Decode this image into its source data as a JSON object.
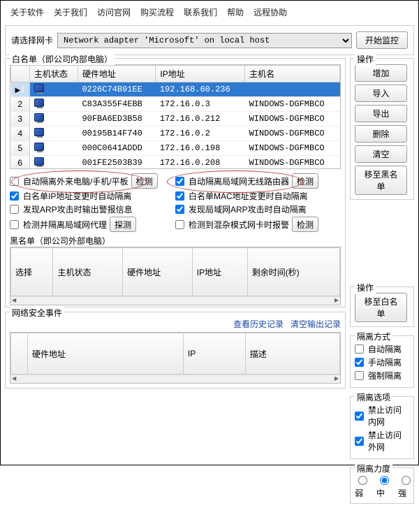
{
  "menubar": [
    "关于软件",
    "关于我们",
    "访问官网",
    "购买流程",
    "联系我们",
    "帮助",
    "远程协助"
  ],
  "adapter": {
    "label": "请选择网卡",
    "value": "Network adapter 'Microsoft' on local host"
  },
  "start_monitor": "开始监控",
  "whitelist": {
    "title": "白名单（即公司内部电脑）",
    "cols": [
      "主机状态",
      "硬件地址",
      "IP地址",
      "主机名"
    ],
    "rows": [
      {
        "n": "1",
        "mac": "0226C74B91EE",
        "ip": "192.168.60.236",
        "host": "",
        "sel": true
      },
      {
        "n": "2",
        "mac": "C83A355F4EBB",
        "ip": "172.16.0.3",
        "host": "WINDOWS-DGFMBCO"
      },
      {
        "n": "3",
        "mac": "90FBA6ED3B58",
        "ip": "172.16.0.212",
        "host": "WINDOWS-DGFMBCO"
      },
      {
        "n": "4",
        "mac": "00195B14F740",
        "ip": "172.16.0.2",
        "host": "WINDOWS-DGFMBCO"
      },
      {
        "n": "5",
        "mac": "000C0641ADDD",
        "ip": "172.16.0.198",
        "host": "WINDOWS-DGFMBCO"
      },
      {
        "n": "6",
        "mac": "001FE2503B39",
        "ip": "172.16.0.208",
        "host": "WINDOWS-DGFMBCO"
      }
    ]
  },
  "ops": {
    "title": "操作",
    "add": "增加",
    "import": "导入",
    "export": "导出",
    "delete": "删除",
    "clear": "清空",
    "to_black": "移至黑名单",
    "to_white": "移至白名单"
  },
  "opts": {
    "auto_isolate_ext": "自动隔离外来电脑/手机/平板",
    "detect": "检测",
    "auto_isolate_router": "自动隔离局域网无线路由器",
    "ip_change_isolate": "白名单IP地址变更时自动隔离",
    "mac_change_isolate": "白名单MAC地址变更时自动隔离",
    "arp_alarm": "发现ARP攻击时输出警报信息",
    "lan_arp_isolate": "发现局域网ARP攻击时自动隔离",
    "detect_proxy": "检测并隔离局域网代理",
    "probe": "探测",
    "mixed_mode_alert": "检测到混杂模式网卡时报警"
  },
  "blacklist": {
    "title": "黑名单（即公司外部电脑）",
    "cols": [
      "选择",
      "主机状态",
      "硬件地址",
      "IP地址",
      "剩余时间(秒)"
    ]
  },
  "isolate_mode": {
    "title": "隔离方式",
    "auto": "自动隔离",
    "manual": "手动隔离",
    "force": "强制隔离"
  },
  "events": {
    "title": "网络安全事件",
    "cols": [
      "",
      "硬件地址",
      "IP",
      "描述"
    ],
    "history": "查看历史记录",
    "clear": "清空输出记录"
  },
  "isolate_opt": {
    "title": "隔离选项",
    "deny_in": "禁止访问内网",
    "deny_out": "禁止访问外网"
  },
  "isolate_level": {
    "title": "隔离力度",
    "weak": "弱",
    "mid": "中",
    "strong": "强"
  }
}
